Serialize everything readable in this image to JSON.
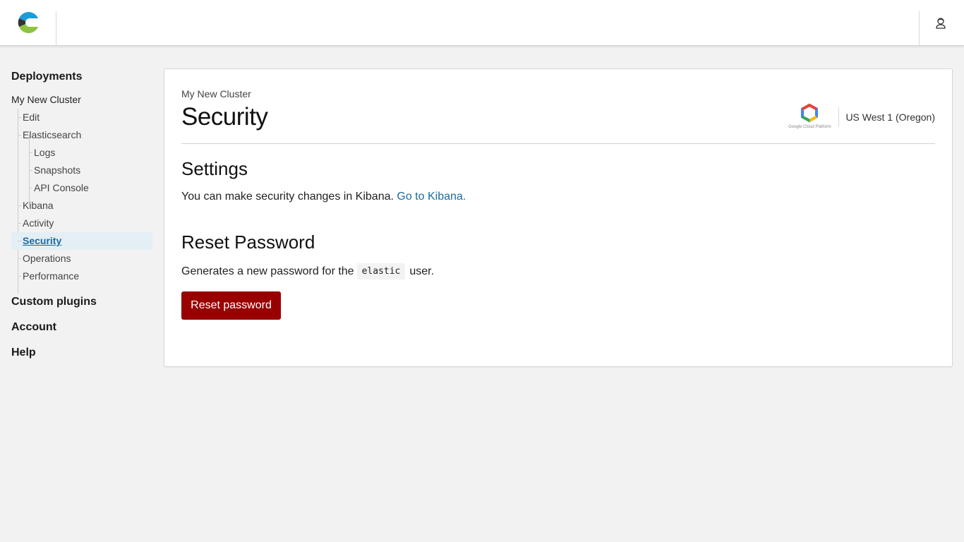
{
  "header": {
    "logo_icon": "elastic-cloud-logo-icon",
    "user_icon": "user-icon"
  },
  "sidebar": {
    "deployments_label": "Deployments",
    "cluster_label": "My New Cluster",
    "items": [
      {
        "label": "Edit"
      },
      {
        "label": "Elasticsearch"
      },
      {
        "label": "Logs"
      },
      {
        "label": "Snapshots"
      },
      {
        "label": "API Console"
      },
      {
        "label": "Kibana"
      },
      {
        "label": "Activity"
      },
      {
        "label": "Security",
        "selected": true
      },
      {
        "label": "Operations"
      },
      {
        "label": "Performance"
      }
    ],
    "custom_plugins_label": "Custom plugins",
    "account_label": "Account",
    "help_label": "Help"
  },
  "main": {
    "breadcrumb": "My New Cluster",
    "title": "Security",
    "provider": {
      "logo_icon": "google-cloud-platform-logo-icon",
      "logo_caption": "Google Cloud Platform",
      "region": "US West 1 (Oregon)"
    },
    "settings": {
      "heading": "Settings",
      "text": "You can make security changes in Kibana.",
      "link_label": "Go to Kibana."
    },
    "reset": {
      "heading": "Reset Password",
      "text_before": "Generates a new password for the",
      "code": "elastic",
      "text_after": "user.",
      "button_label": "Reset password"
    }
  },
  "colors": {
    "accent_link": "#1b6a9c",
    "danger_button": "#990000",
    "selected_bg": "#e3eff5",
    "page_bg": "#f2f2f2"
  }
}
